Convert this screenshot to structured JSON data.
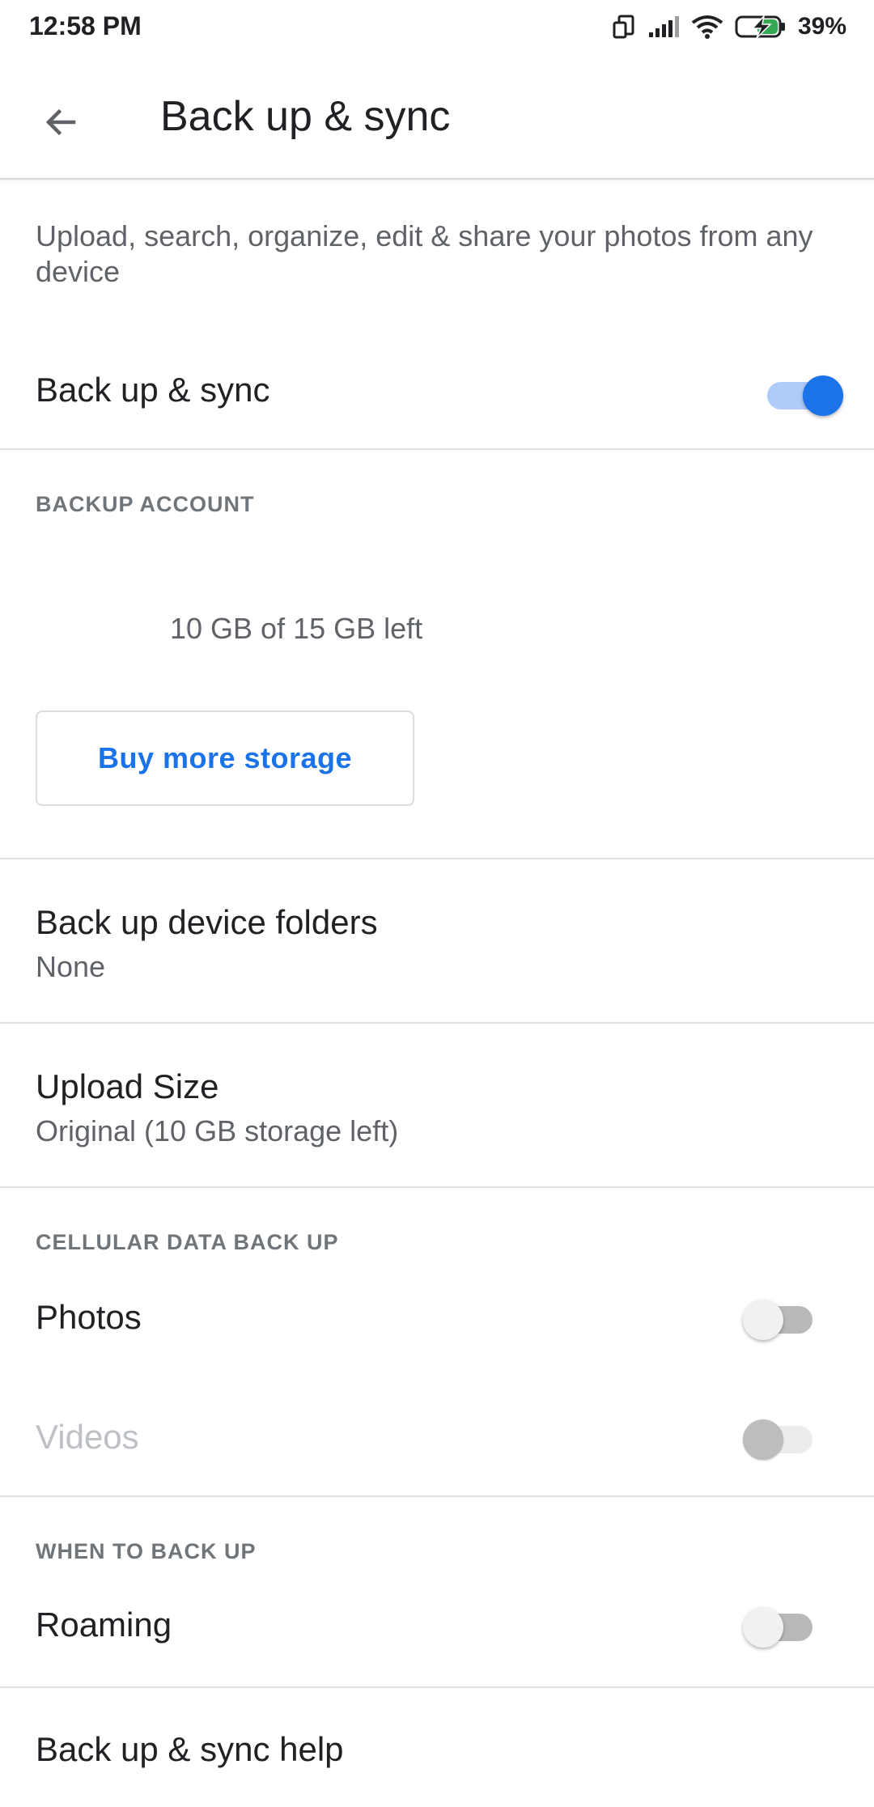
{
  "status_bar": {
    "time": "12:58 PM",
    "battery": "39%",
    "icons": [
      "screen-rotate-icon",
      "signal-icon",
      "wifi-icon",
      "battery-charging-icon"
    ]
  },
  "app_bar": {
    "back_icon": "arrow-back-icon",
    "title": "Back up & sync"
  },
  "description": "Upload, search, organize, edit & share your photos from any device",
  "backup_sync": {
    "label": "Back up & sync",
    "enabled": true
  },
  "backup_account": {
    "header": "BACKUP ACCOUNT",
    "storage_text": "10 GB of 15 GB left",
    "buy_button": "Buy more storage"
  },
  "device_folders": {
    "title": "Back up device folders",
    "value": "None"
  },
  "upload_size": {
    "title": "Upload Size",
    "value": "Original (10 GB storage left)"
  },
  "cellular": {
    "header": "CELLULAR DATA BACK UP",
    "photos": {
      "label": "Photos",
      "enabled": false
    },
    "videos": {
      "label": "Videos",
      "enabled": false,
      "disabled": true
    }
  },
  "when_to_backup": {
    "header": "WHEN TO BACK UP",
    "roaming": {
      "label": "Roaming",
      "enabled": false
    }
  },
  "help": {
    "label": "Back up & sync help"
  },
  "colors": {
    "accent": "#1a73e8",
    "accent_track": "#aecbfa"
  }
}
